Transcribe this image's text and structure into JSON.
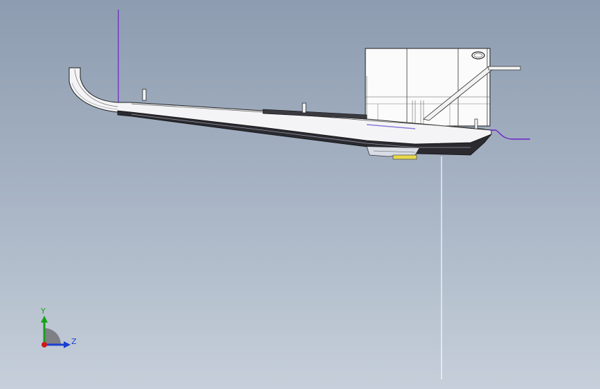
{
  "viewport": {
    "background_top": "#8d9cb0",
    "background_bottom": "#c6cfda"
  },
  "model": {
    "name": "boat-hull-side-view",
    "colors": {
      "hull_fill": "#f4f4f6",
      "hull_edge": "#1c1c1c",
      "keel_dark": "#2a2a30",
      "deck_band": "#3a3a40",
      "cabin_fill": "#fbfbfb",
      "sketch_line": "#6a22c8",
      "highlight": "#e8d84a"
    }
  },
  "triad": {
    "y_label": "Y",
    "z_label": "Z",
    "y_color": "#18a018",
    "z_color": "#1a3fd0",
    "x_color": "#d01818"
  }
}
